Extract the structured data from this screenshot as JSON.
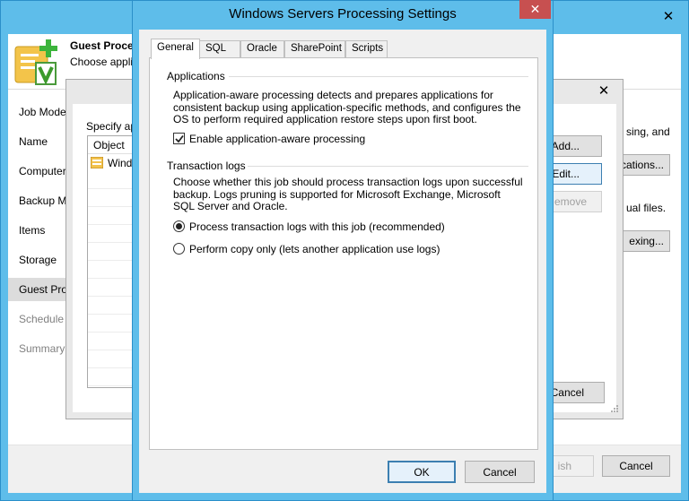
{
  "wizard": {
    "header_title": "Guest Proces",
    "header_subtitle": "Choose appli",
    "nav": [
      {
        "label": "Job Mode",
        "disabled": false
      },
      {
        "label": "Name",
        "disabled": false
      },
      {
        "label": "Computer",
        "disabled": false
      },
      {
        "label": "Backup M",
        "disabled": false
      },
      {
        "label": "Items",
        "disabled": false
      },
      {
        "label": "Storage",
        "disabled": false
      },
      {
        "label": "Guest Pro",
        "disabled": false
      },
      {
        "label": "Schedule",
        "disabled": true
      },
      {
        "label": "Summary",
        "disabled": true
      }
    ],
    "right_text_1": "sing, and",
    "right_text_2": "ual files.",
    "applications_button": "cations...",
    "indexing_button": "exing...",
    "finish_button": "ish",
    "cancel_button": "Cancel"
  },
  "mid_dialog": {
    "specify_label": "Specify ap",
    "object_header": "Object",
    "object_row": "Wind",
    "add_button": "Add...",
    "edit_button": "Edit...",
    "remove_button": "emove",
    "cancel_button": "Cancel"
  },
  "dialog": {
    "title": "Windows Servers Processing Settings",
    "tabs": [
      "General",
      "SQL",
      "Oracle",
      "SharePoint",
      "Scripts"
    ],
    "applications_group": "Applications",
    "applications_desc": "Application-aware processing detects and prepares applications for consistent backup using application-specific methods, and configures the OS to perform required application restore steps upon first boot.",
    "enable_aap": "Enable application-aware processing",
    "enable_aap_checked": true,
    "translogs_group": "Transaction logs",
    "translogs_desc": "Choose whether this job should process transaction logs upon successful backup. Logs pruning is supported for Microsoft Exchange, Microsoft SQL Server and Oracle.",
    "radio_process": "Process transaction logs with this job (recommended)",
    "radio_copyonly": "Perform copy only (lets another application use logs)",
    "selected_radio": "process",
    "ok_button": "OK",
    "cancel_button": "Cancel"
  }
}
